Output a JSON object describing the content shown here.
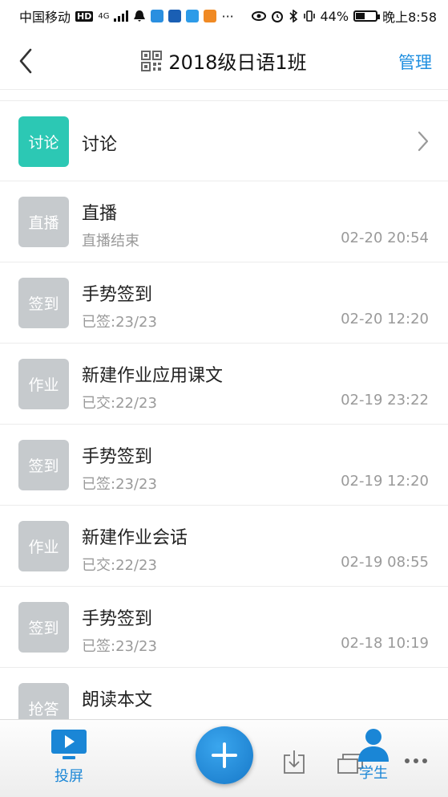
{
  "status_bar": {
    "carrier": "中国移动",
    "hd": "HD",
    "network": "4G",
    "ellipsis": "···",
    "battery_percent": "44%",
    "battery_level": 0.44,
    "time": "晚上8:58"
  },
  "header": {
    "back_icon": "chevron-left-icon",
    "qr_icon": "qr-code-icon",
    "title": "2018级日语1班",
    "manage_label": "管理"
  },
  "discussion": {
    "badge": "讨论",
    "title": "讨论"
  },
  "activities": [
    {
      "badge": "直播",
      "title": "直播",
      "status": "直播结束",
      "time": "02-20 20:54"
    },
    {
      "badge": "签到",
      "title": "手势签到",
      "status": "已签:23/23",
      "time": "02-20 12:20"
    },
    {
      "badge": "作业",
      "title": "新建作业应用课文",
      "status": "已交:22/23",
      "time": "02-19 23:22"
    },
    {
      "badge": "签到",
      "title": "手势签到",
      "status": "已签:23/23",
      "time": "02-19 12:20"
    },
    {
      "badge": "作业",
      "title": "新建作业会话",
      "status": "已交:22/23",
      "time": "02-19 08:55"
    },
    {
      "badge": "签到",
      "title": "手势签到",
      "status": "已签:23/23",
      "time": "02-18 10:19"
    },
    {
      "badge": "抢答",
      "title": "朗读本文",
      "status": "",
      "time": ""
    }
  ],
  "bottom_bar": {
    "screen_label": "投屏",
    "student_label": "学生",
    "add_icon": "plus-icon",
    "download_icon": "download-icon",
    "window_icon": "window-icon",
    "more_icon": "more-icon"
  },
  "colors": {
    "accent": "#1f8fe0",
    "teal_badge": "#2cc8b4",
    "gray_badge": "#c6cacd"
  }
}
